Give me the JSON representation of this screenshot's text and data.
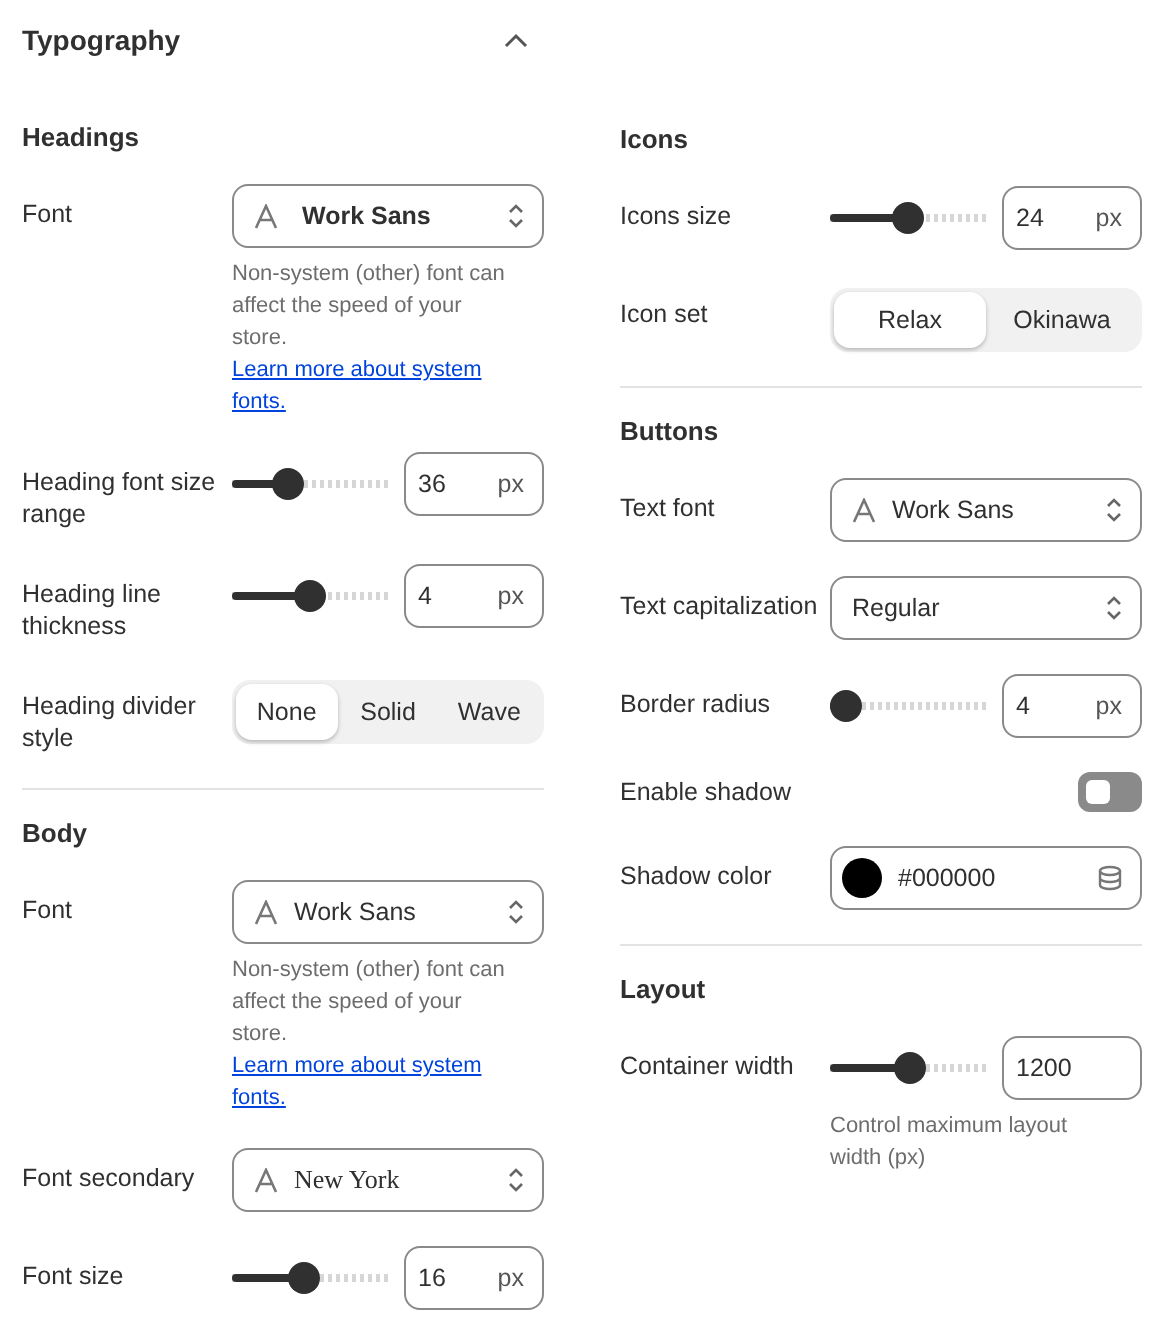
{
  "panel": {
    "title": "Typography",
    "expanded": true
  },
  "columns": [
    [
      {
        "heading": "Headings",
        "settings": [
          {
            "kind": "select",
            "label": "Font",
            "value": "Work Sans",
            "bold": true,
            "serif": false,
            "font_icon": true,
            "note": "Non-system (other) font can affect the speed of your store.",
            "link": "Learn more about system fonts."
          },
          {
            "kind": "slider",
            "label": "Heading font size range",
            "level": 0.32,
            "value": "36",
            "unit": "px"
          },
          {
            "kind": "slider",
            "label": "Heading line thickness",
            "level": 0.5,
            "value": "4",
            "unit": "px"
          },
          {
            "kind": "segmented",
            "label": "Heading divider style",
            "options": [
              {
                "label": "None",
                "selected": true
              },
              {
                "label": "Solid",
                "selected": false
              },
              {
                "label": "Wave",
                "selected": false
              }
            ]
          }
        ]
      },
      {
        "heading": "Body",
        "settings": [
          {
            "kind": "select",
            "label": "Font",
            "value": "Work Sans",
            "bold": false,
            "serif": false,
            "font_icon": true,
            "note": "Non-system (other) font can affect the speed of your store.",
            "link": "Learn more about system fonts."
          },
          {
            "kind": "select",
            "label": "Font secondary",
            "value": "New York",
            "bold": false,
            "serif": true,
            "font_icon": true
          },
          {
            "kind": "slider",
            "label": "Font size",
            "level": 0.45,
            "value": "16",
            "unit": "px"
          }
        ]
      }
    ],
    [
      {
        "heading": "Icons",
        "settings": [
          {
            "kind": "slider",
            "label": "Icons size",
            "level": 0.5,
            "value": "24",
            "unit": "px"
          },
          {
            "kind": "segmented",
            "label": "Icon set",
            "options": [
              {
                "label": "Relax",
                "selected": true
              },
              {
                "label": "Okinawa",
                "selected": false
              }
            ]
          }
        ]
      },
      {
        "heading": "Buttons",
        "settings": [
          {
            "kind": "select",
            "label": "Text font",
            "value": "Work Sans",
            "bold": false,
            "serif": false,
            "font_icon": true
          },
          {
            "kind": "select",
            "label": "Text capitalization",
            "value": "Regular",
            "bold": false,
            "serif": false,
            "font_icon": false
          },
          {
            "kind": "slider",
            "label": "Border radius",
            "level": 0,
            "value": "4",
            "unit": "px"
          },
          {
            "kind": "toggle",
            "label": "Enable shadow",
            "on": false
          },
          {
            "kind": "color",
            "label": "Shadow color",
            "color": "#000000",
            "value": "#000000"
          }
        ]
      },
      {
        "heading": "Layout",
        "settings": [
          {
            "kind": "slider",
            "label": "Container width",
            "level": 0.52,
            "value": "1200",
            "note": "Control maximum layout width (px)"
          }
        ]
      }
    ]
  ]
}
